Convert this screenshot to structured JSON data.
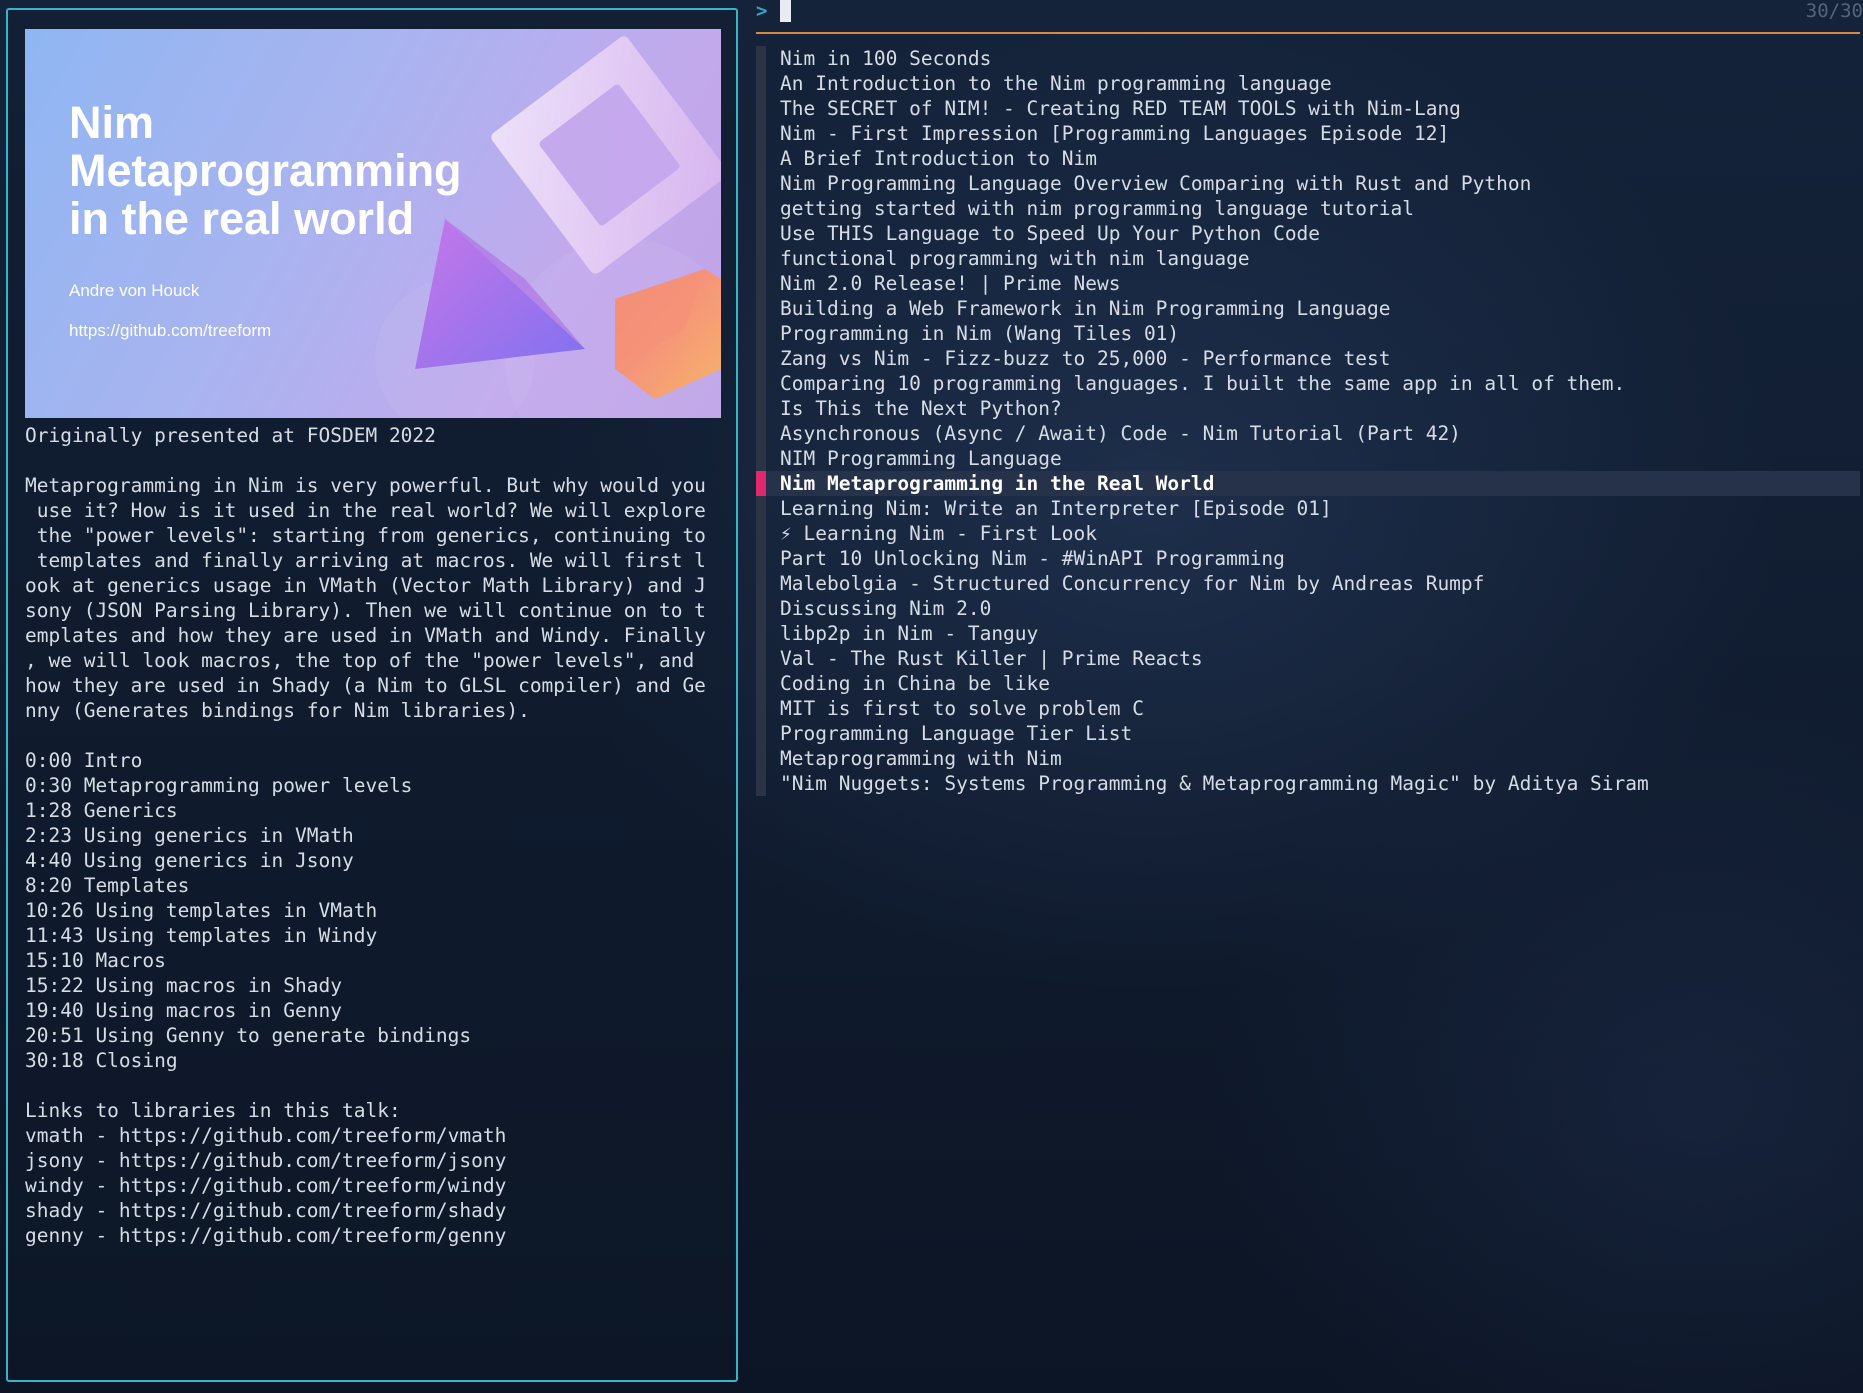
{
  "preview": {
    "thumbnail": {
      "title": "Nim\nMetaprogramming\nin the real world",
      "author": "Andre von Houck",
      "link": "https://github.com/treeform"
    },
    "description_lines": [
      "Originally presented at FOSDEM 2022",
      "",
      "Metaprogramming in Nim is very powerful. But why would you",
      " use it? How is it used in the real world? We will explore",
      " the \"power levels\": starting from generics, continuing to",
      " templates and finally arriving at macros. We will first l",
      "ook at generics usage in VMath (Vector Math Library) and J",
      "sony (JSON Parsing Library). Then we will continue on to t",
      "emplates and how they are used in VMath and Windy. Finally",
      ", we will look macros, the top of the \"power levels\", and",
      "how they are used in Shady (a Nim to GLSL compiler) and Ge",
      "nny (Generates bindings for Nim libraries).",
      "",
      "0:00 Intro",
      "0:30 Metaprogramming power levels",
      "1:28 Generics",
      "2:23 Using generics in VMath",
      "4:40 Using generics in Jsony",
      "8:20 Templates",
      "10:26 Using templates in VMath",
      "11:43 Using templates in Windy",
      "15:10 Macros",
      "15:22 Using macros in Shady",
      "19:40 Using macros in Genny",
      "20:51 Using Genny to generate bindings",
      "30:18 Closing",
      "",
      "Links to libraries in this talk:",
      "vmath - https://github.com/treeform/vmath",
      "jsony - https://github.com/treeform/jsony",
      "windy - https://github.com/treeform/windy",
      "shady - https://github.com/treeform/shady",
      "genny - https://github.com/treeform/genny"
    ]
  },
  "finder": {
    "prompt": ">",
    "query": "",
    "counter": "30/30",
    "selected_index": 17,
    "items": [
      "Nim in 100 Seconds",
      "An Introduction to the Nim programming language",
      "The SECRET of NIM! - Creating RED TEAM TOOLS with Nim-Lang",
      "Nim - First Impression [Programming Languages Episode 12]",
      "A Brief Introduction to Nim",
      "Nim Programming Language Overview Comparing with Rust and Python",
      "getting started with nim programming language tutorial",
      "Use THIS Language to Speed Up Your Python Code",
      "functional programming with nim language",
      "Nim 2.0 Release! | Prime News",
      "Building a Web Framework in Nim Programming Language",
      "Programming in Nim (Wang Tiles 01)",
      "Zang vs Nim - Fizz-buzz to 25,000 - Performance test",
      "Comparing 10 programming languages. I built the same app in all of them.",
      "Is This the Next Python?",
      "Asynchronous (Async / Await) Code - Nim Tutorial (Part 42)",
      "NIM Programming Language",
      "Nim Metaprogramming in the Real World",
      "Learning Nim: Write an Interpreter [Episode 01]",
      "⚡ Learning Nim - First Look",
      "Part 10 Unlocking Nim - #WinAPI Programming",
      "Malebolgia - Structured Concurrency for Nim by Andreas Rumpf",
      "Discussing Nim 2.0",
      "libp2p in Nim - Tanguy",
      "Val - The Rust Killer | Prime Reacts",
      "Coding in China be like",
      "MIT is first to solve problem C",
      "Programming Language Tier List",
      "Metaprogramming with Nim",
      "\"Nim Nuggets: Systems Programming & Metaprogramming Magic\" by Aditya Siram"
    ]
  },
  "colors": {
    "border_accent": "#37b4c8",
    "separator": "#d88a42",
    "selection_marker": "#e0286e",
    "selection_bg": "#26314a"
  }
}
